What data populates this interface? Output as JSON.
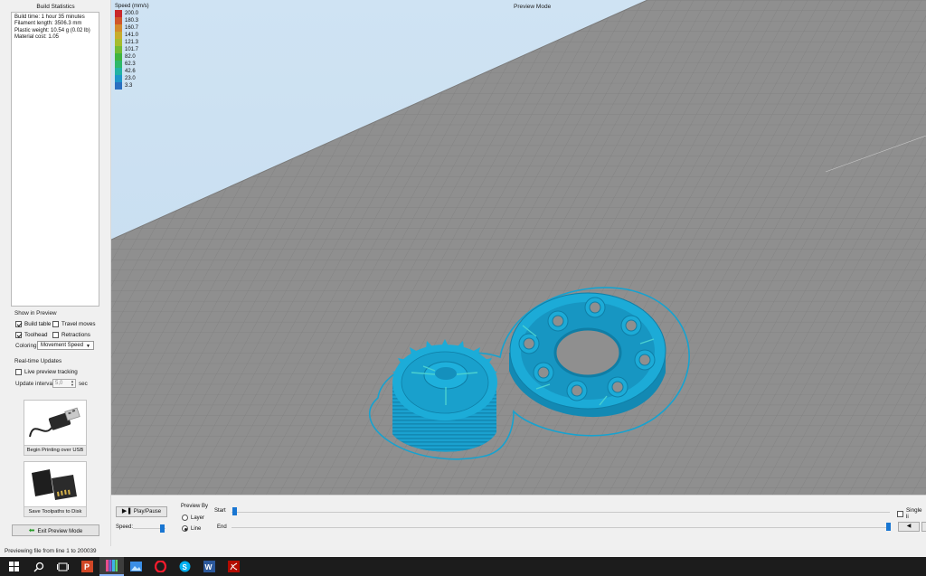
{
  "left_panel": {
    "title": "Build Statistics",
    "stats": [
      "Build time: 1 hour 35 minutes",
      "Filament length: 3506.3 mm",
      "Plastic weight: 10.54 g (0.02 lb)",
      "Material cost: 1.05"
    ],
    "show_in_preview": {
      "label": "Show in Preview",
      "build_table": "Build table",
      "build_table_checked": true,
      "travel_moves": "Travel moves",
      "travel_moves_checked": false,
      "toolhead": "Toolhead",
      "toolhead_checked": true,
      "retractions": "Retractions",
      "retractions_checked": false,
      "coloring_label": "Coloring",
      "coloring_value": "Movement Speed"
    },
    "realtime": {
      "label": "Real-time Updates",
      "live_tracking": "Live preview tracking",
      "live_tracking_checked": false,
      "update_interval_label": "Update interval",
      "update_interval_value": "5,0",
      "update_interval_unit": "sec"
    },
    "usb_button": "Begin Printing over USB",
    "disk_button": "Save Toolpaths to Disk",
    "exit_button": "Exit Preview Mode"
  },
  "viewport": {
    "mode_title": "Preview Mode",
    "legend": {
      "title": "Speed (mm/s)",
      "items": [
        {
          "value": "200.0",
          "color": "#c8282a"
        },
        {
          "value": "180.3",
          "color": "#d0562a"
        },
        {
          "value": "160.7",
          "color": "#d38a2d"
        },
        {
          "value": "141.0",
          "color": "#c7ad2d"
        },
        {
          "value": "121.3",
          "color": "#a6bc2e"
        },
        {
          "value": "101.7",
          "color": "#72bb35"
        },
        {
          "value": "82.0",
          "color": "#3fb43f"
        },
        {
          "value": "62.3",
          "color": "#2eb86a"
        },
        {
          "value": "42.6",
          "color": "#22b3a3"
        },
        {
          "value": "23.0",
          "color": "#1e96c8"
        },
        {
          "value": "3.3",
          "color": "#2a6fc0"
        }
      ]
    },
    "part_color": "#17a2cf"
  },
  "controls": {
    "play_pause": "Play/Pause",
    "speed_label": "Speed:",
    "preview_by_label": "Preview By",
    "layer_option": "Layer",
    "line_option": "Line",
    "selected_option": "Line",
    "start_label": "Start",
    "end_label": "End",
    "single_line_label": "Single li"
  },
  "status": "Previewing file from line 1 to 200039",
  "taskbar": {
    "icons": [
      "windows-start-icon",
      "search-icon",
      "task-view-icon",
      "powerpoint-icon",
      "simplify3d-icon",
      "photos-icon",
      "opera-icon",
      "skype-icon",
      "word-icon",
      "acrobat-icon"
    ]
  }
}
